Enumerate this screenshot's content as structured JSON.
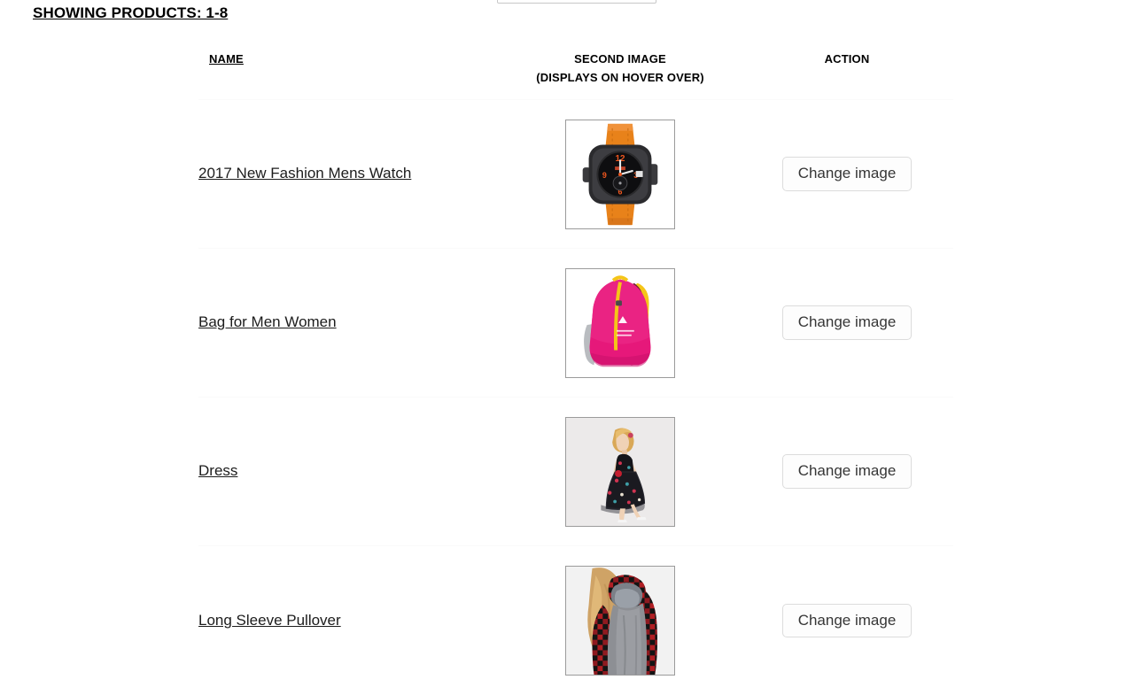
{
  "page": {
    "heading": "SHOWING PRODUCTS: 1-8"
  },
  "top_partial_control": {
    "name": "cut-off-input-box"
  },
  "table": {
    "headers": {
      "name": "NAME",
      "second_image": "SECOND IMAGE",
      "second_image_sub": "(DISPLAYS ON HOVER OVER)",
      "action": "ACTION"
    },
    "rows": [
      {
        "name": "2017 New Fashion Mens Watch",
        "image_alt": "mens-watch-orange-leather-strap",
        "action_label": "Change image"
      },
      {
        "name": "Bag for Men Women",
        "image_alt": "pink-backpack-yellow-zipper",
        "action_label": "Change image"
      },
      {
        "name": "Dress",
        "image_alt": "woman-in-black-floral-dress",
        "action_label": "Change image"
      },
      {
        "name": "Long Sleeve Pullover",
        "image_alt": "woman-in-gray-plaid-cowlneck-pullover",
        "action_label": "Change image"
      }
    ]
  },
  "colors": {
    "text": "#1a1a1a",
    "link": "#1c1c1c",
    "button_border": "#dcdcdc",
    "button_text": "#363636",
    "thumb_border": "#9b9b9b",
    "row_divider": "#fafafa",
    "watch_strap": "#e8821a",
    "backpack_pink": "#e6187a",
    "backpack_yellow": "#f5c518",
    "plaid_red": "#b01f24",
    "pullover_gray": "#8d8f94"
  }
}
